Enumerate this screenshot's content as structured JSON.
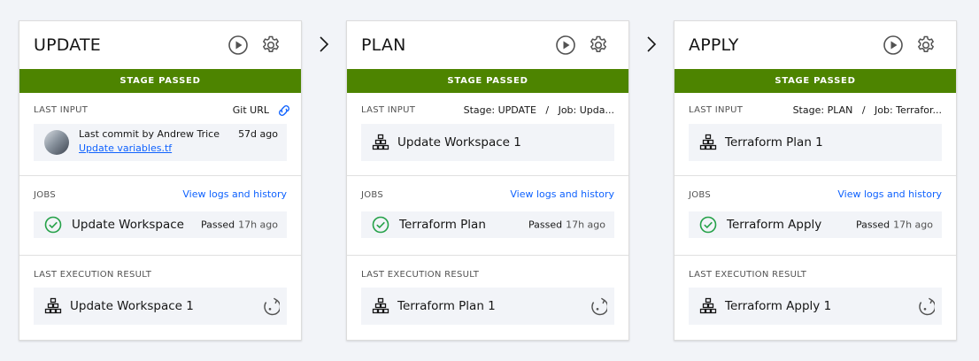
{
  "stages": [
    {
      "title": "UPDATE",
      "status": "STAGE PASSED",
      "input_label": "LAST INPUT",
      "input_right": "Git URL",
      "commit": {
        "author": "Last commit by Andrew Trice",
        "age": "57d ago",
        "file": "Update variables.tf"
      },
      "jobs_label": "JOBS",
      "jobs_link": "View logs and history",
      "job": {
        "name": "Update Workspace",
        "status": "Passed",
        "time": "17h ago"
      },
      "result_label": "LAST EXECUTION RESULT",
      "result": "Update Workspace 1"
    },
    {
      "title": "PLAN",
      "status": "STAGE PASSED",
      "input_label": "LAST INPUT",
      "input_right": "Stage: UPDATE   /   Job: Upda...",
      "input_tile": "Update Workspace 1",
      "jobs_label": "JOBS",
      "jobs_link": "View logs and history",
      "job": {
        "name": "Terraform Plan",
        "status": "Passed",
        "time": "17h ago"
      },
      "result_label": "LAST EXECUTION RESULT",
      "result": "Terraform Plan 1"
    },
    {
      "title": "APPLY",
      "status": "STAGE PASSED",
      "input_label": "LAST INPUT",
      "input_right": "Stage: PLAN   /   Job: Terrafor...",
      "input_tile": "Terraform Plan 1",
      "jobs_label": "JOBS",
      "jobs_link": "View logs and history",
      "job": {
        "name": "Terraform Apply",
        "status": "Passed",
        "time": "17h ago"
      },
      "result_label": "LAST EXECUTION RESULT",
      "result": "Terraform Apply 1"
    }
  ],
  "colors": {
    "status_green": "#4d8400",
    "link_blue": "#0f62fe",
    "check_green": "#24a148"
  }
}
